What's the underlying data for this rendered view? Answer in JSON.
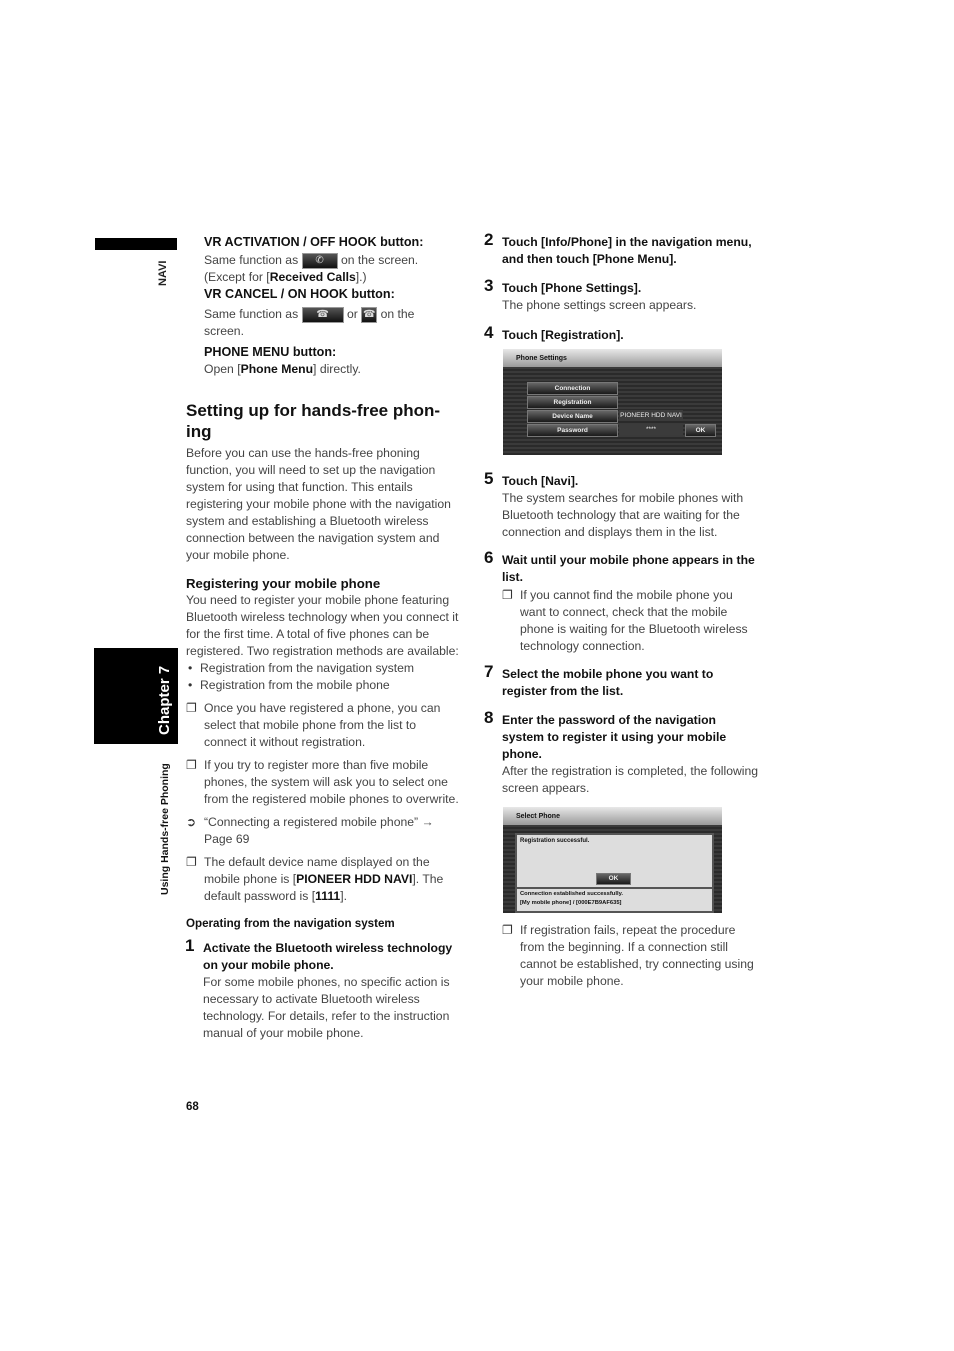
{
  "sidebar": {
    "top_label": "NAVI",
    "chapter_label": "Chapter 7",
    "section_label": "Using Hands-free Phoning"
  },
  "left": {
    "vr_activation": {
      "label": "VR ACTIVATION / OFF HOOK button:",
      "text_before": "Same function as",
      "text_after": "on the screen.",
      "except_prefix": "(Except for [",
      "except_bold": "Received Calls",
      "except_suffix": "].)",
      "icon": "phone-off-hook-icon"
    },
    "vr_cancel": {
      "label": "VR CANCEL / ON HOOK button:",
      "text_before": "Same function as",
      "text_or": "or",
      "text_after": "on the",
      "text_line2": "screen.",
      "icon": "phone-on-hook-icon"
    },
    "phone_menu": {
      "label": "PHONE MENU button:",
      "prefix": "Open [",
      "bold": "Phone Menu",
      "suffix": "] directly."
    },
    "heading": "Setting up for hands-free phon-ing",
    "heading_line1": "Setting up for hands-free phon-",
    "heading_line2": "ing",
    "intro": "Before you can use the hands-free phoning function, you will need to set up the navigation system for using that function. This entails registering your mobile phone with the navigation system and establishing a Bluetooth wireless connection between the navigation system and your mobile phone.",
    "registering": {
      "heading": "Registering your mobile phone",
      "text": "You need to register your mobile phone featuring Bluetooth wireless technology when you connect it for the first time. A total of five phones can be registered. Two registration methods are available:",
      "bullets": [
        "Registration from the navigation system",
        "Registration from the mobile phone"
      ],
      "note1": "Once you have registered a phone, you can select that mobile phone from the list to connect it without registration.",
      "note2": "If you try to register more than five mobile phones, the system will ask you to select one from the registered mobile phones to overwrite.",
      "ref_text": "“Connecting a registered mobile phone” → Page 69",
      "note3_prefix": "The default device name displayed on the mobile phone is [",
      "note3_bold1": "PIONEER HDD NAVI",
      "note3_mid": "]. The default password is [",
      "note3_bold2": "1111",
      "note3_suffix": "]."
    },
    "operating_heading": "Operating from the navigation system",
    "step1": {
      "num": "1",
      "title": "Activate the Bluetooth wireless technology on your mobile phone.",
      "text": "For some mobile phones, no specific action is necessary to activate Bluetooth wireless technology. For details, refer to the instruction manual of your mobile phone."
    },
    "page_number": "68"
  },
  "right": {
    "steps": [
      {
        "num": "2",
        "title": "Touch [Info/Phone] in the navigation menu, and then touch [Phone Menu].",
        "text": ""
      },
      {
        "num": "3",
        "title": "Touch [Phone Settings].",
        "text": "The phone settings screen appears."
      },
      {
        "num": "4",
        "title": "Touch [Registration].",
        "text": ""
      },
      {
        "num": "5",
        "title": "Touch [Navi].",
        "text": "The system searches for mobile phones with Bluetooth technology that are waiting for the connection and displays them in the list."
      },
      {
        "num": "6",
        "title": "Wait until your mobile phone appears in the list.",
        "text": ""
      },
      {
        "num": "7",
        "title": "Select the mobile phone you want to register from the list.",
        "text": ""
      },
      {
        "num": "8",
        "title": "Enter the password of the navigation system to register it using your mobile phone.",
        "text": "After the registration is completed, the following screen appears."
      }
    ],
    "step6_note": "If you cannot find the mobile phone you want to connect, check that the mobile phone is waiting for the Bluetooth wireless technology connection.",
    "final_note": "If registration fails, repeat the procedure from the beginning. If a connection still cannot be established, try connecting using your mobile phone."
  },
  "screen_phone_settings": {
    "title": "Phone Settings",
    "buttons": [
      "Connection",
      "Registration",
      "Device Name",
      "Password"
    ],
    "device_name_value": "PIONEER HDD NAVI",
    "password_value": "****",
    "ok_label": "OK"
  },
  "screen_select_phone": {
    "title": "Select Phone",
    "dialog_text": "Registration successful.",
    "ok_label": "OK",
    "status_line1": "Connection established successfully.",
    "status_line2": "[My mobile phone] / [000E7B9AF635]"
  }
}
